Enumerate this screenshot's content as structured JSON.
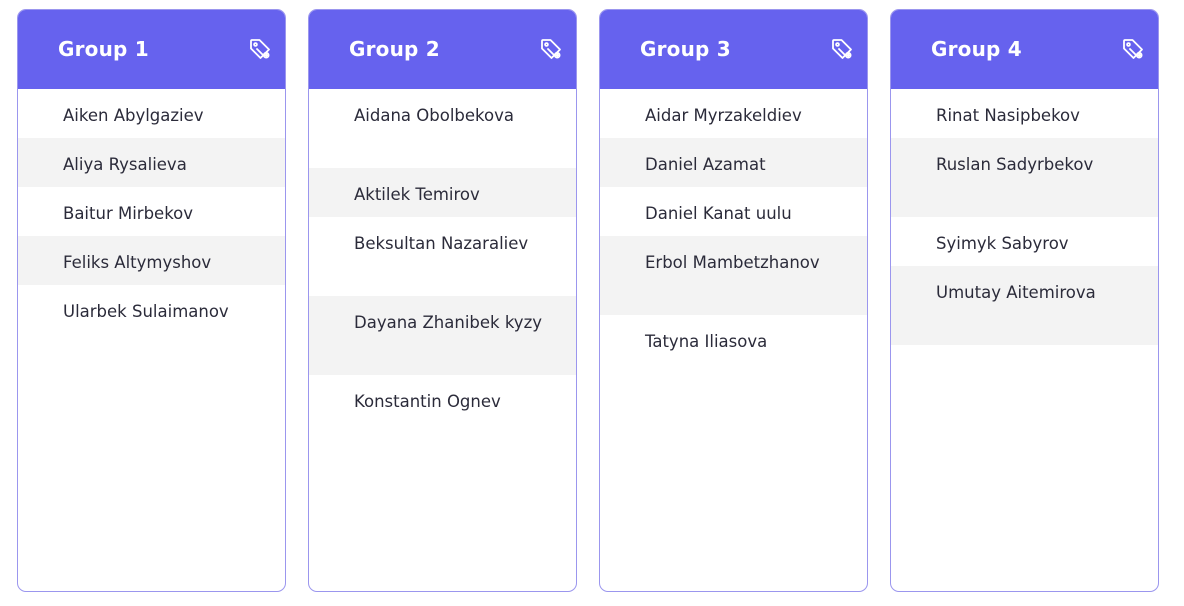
{
  "colors": {
    "header_bg": "#6662ee",
    "border": "#9b96ee",
    "row_alt": "#f3f3f3",
    "text": "#2b2b3a"
  },
  "icons": {
    "header_action": "tag-icon"
  },
  "groups": [
    {
      "title": "Group 1",
      "members": [
        {
          "name": "Aiken Abylgaziev"
        },
        {
          "name": "Aliya Rysalieva"
        },
        {
          "name": "Baitur Mirbekov"
        },
        {
          "name": "Feliks Altymyshov"
        },
        {
          "name": "Ularbek Sulaimanov"
        }
      ]
    },
    {
      "title": "Group 2",
      "members": [
        {
          "name": "Aidana Obolbekova"
        },
        {
          "name": "Aktilek Temirov"
        },
        {
          "name": "Beksultan Nazaraliev"
        },
        {
          "name": "Dayana Zhanibek kyzy"
        },
        {
          "name": "Konstantin Ognev"
        }
      ]
    },
    {
      "title": "Group 3",
      "members": [
        {
          "name": "Aidar Myrzakeldiev"
        },
        {
          "name": "Daniel Azamat"
        },
        {
          "name": "Daniel Kanat uulu"
        },
        {
          "name": "Erbol Mambetzhanov"
        },
        {
          "name": "Tatyna Iliasova"
        }
      ]
    },
    {
      "title": "Group 4",
      "members": [
        {
          "name": "Rinat Nasipbekov"
        },
        {
          "name": "Ruslan Sadyrbekov"
        },
        {
          "name": "Syimyk Sabyrov"
        },
        {
          "name": "Umutay Aitemirova"
        }
      ]
    }
  ]
}
